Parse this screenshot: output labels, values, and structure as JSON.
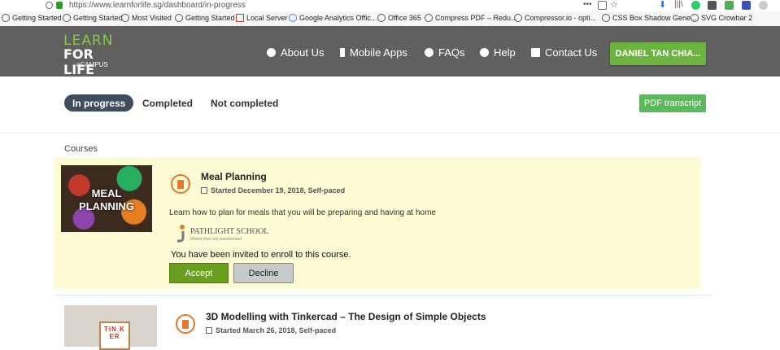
{
  "browser": {
    "url": "https://www.learnforlife.sg/dashboard/in-progress",
    "bookmarks": [
      "Getting Started",
      "Getting Started",
      "Most Visited",
      "Getting Started",
      "Local Server",
      "Google Analytics Offic...",
      "Office 365",
      "Compress PDF – Redu...",
      "Compressor.io - opti...",
      "CSS Box Shadow Gene...",
      "SVG Crowbar 2"
    ]
  },
  "header": {
    "logo_line1": "LEARN",
    "logo_line2": "FOR LIFE",
    "logo_line3": "eCAMPUS",
    "nav": [
      "About Us",
      "Mobile Apps",
      "FAQs",
      "Help",
      "Contact Us"
    ],
    "user_button": "DANIEL TAN CHIA..."
  },
  "filters": {
    "tabs": [
      "In progress",
      "Completed",
      "Not completed"
    ],
    "active": "In progress",
    "pdf_button": "PDF transcript"
  },
  "courses_label": "Courses",
  "courses": [
    {
      "thumb_text_1": "MEAL",
      "thumb_text_2": "PLANNING",
      "title": "Meal Planning",
      "meta": "Started December 19, 2018, Self-paced",
      "description": "Learn how to plan for meals that you will be preparing and having at home",
      "school_name": "PATHLIGHT SCHOOL",
      "school_tagline": "Where lives are transformed",
      "invite_text": "You have been invited to enroll to this course.",
      "accept_label": "Accept",
      "decline_label": "Decline"
    },
    {
      "title": "3D Modelling with Tinkercad – The Design of Simple Objects",
      "meta": "Started March 26, 2018, Self-paced",
      "thumb_text": "TIN KER"
    }
  ],
  "colors": {
    "header_bg": "#606060",
    "accent_green": "#6db33f",
    "course_icon": "#e8762c",
    "card_bg": "#fdfbd3"
  }
}
